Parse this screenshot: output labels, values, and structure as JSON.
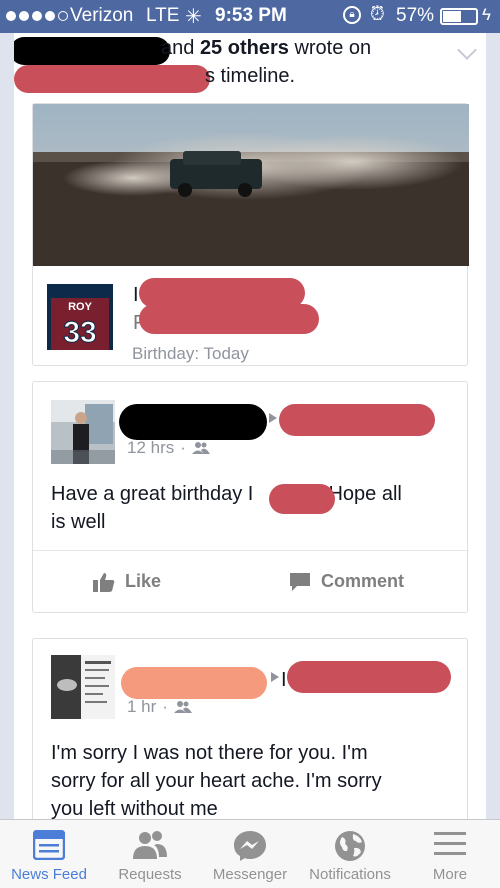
{
  "status_bar": {
    "carrier": "Verizon",
    "network": "LTE",
    "time": "9:53 PM",
    "battery_percent": "57%",
    "battery_level": 0.57
  },
  "story": {
    "line1_suffix": "and",
    "line1_count": "25 others",
    "line1_rest": "wrote on",
    "line2_suffix": "s timeline."
  },
  "birthday_card": {
    "jersey_name": "ROY",
    "jersey_number": "33",
    "line1_initial": "I",
    "line2_initial": "F",
    "birthday_text": "Birthday: Today"
  },
  "post1": {
    "time": "12 hrs",
    "text_before": "Have a great birthday",
    "text_initial": "I",
    "text_after": ". Hope all",
    "text_line2": "is well",
    "like_label": "Like",
    "comment_label": "Comment"
  },
  "post2": {
    "time": "1 hr",
    "name_initial": "I",
    "text_line1": "I'm sorry I was not there for you.  I'm",
    "text_line2": "sorry for all your heart ache. I'm sorry",
    "text_line3": "you left without me"
  },
  "tabs": [
    {
      "label": "News Feed",
      "icon": "news-feed-icon",
      "active": true
    },
    {
      "label": "Requests",
      "icon": "friend-requests-icon",
      "active": false
    },
    {
      "label": "Messenger",
      "icon": "messenger-icon",
      "active": false
    },
    {
      "label": "Notifications",
      "icon": "globe-icon",
      "active": false
    },
    {
      "label": "More",
      "icon": "menu-icon",
      "active": false
    }
  ],
  "colors": {
    "status_bar": "#4e69a2",
    "tab_active": "#4c7ed9",
    "tab_inactive": "#929292"
  }
}
